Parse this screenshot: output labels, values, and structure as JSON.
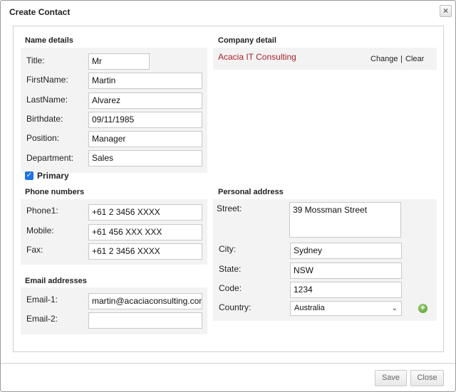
{
  "dialog": {
    "title": "Create Contact",
    "close_icon": "×"
  },
  "name_details": {
    "heading": "Name details",
    "title_label": "Title:",
    "title_value": "Mr",
    "firstname_label": "FirstName:",
    "firstname_value": "Martin",
    "lastname_label": "LastName:",
    "lastname_value": "Alvarez",
    "birthdate_label": "Birthdate:",
    "birthdate_value": "09/11/1985",
    "position_label": "Position:",
    "position_value": "Manager",
    "department_label": "Department:",
    "department_value": "Sales"
  },
  "primary": {
    "label": "Primary",
    "checked": true
  },
  "company_detail": {
    "heading": "Company detail",
    "name": "Acacia IT Consulting",
    "change_label": "Change",
    "separator": "|",
    "clear_label": "Clear"
  },
  "phone_numbers": {
    "heading": "Phone numbers",
    "phone1_label": "Phone1:",
    "phone1_value": "+61 2 3456 XXXX",
    "mobile_label": "Mobile:",
    "mobile_value": "+61 456 XXX XXX",
    "fax_label": "Fax:",
    "fax_value": "+61 2 3456 XXXX"
  },
  "email_addresses": {
    "heading": "Email addresses",
    "email1_label": "Email-1:",
    "email1_value": "martin@acaciaconsulting.com",
    "email2_label": "Email-2:",
    "email2_value": ""
  },
  "personal_address": {
    "heading": "Personal address",
    "street_label": "Street:",
    "street_value": "39 Mossman Street",
    "city_label": "City:",
    "city_value": "Sydney",
    "state_label": "State:",
    "state_value": "NSW",
    "code_label": "Code:",
    "code_value": "1234",
    "country_label": "Country:",
    "country_value": "Australia"
  },
  "footer": {
    "save_label": "Save",
    "close_label": "Close"
  },
  "colors": {
    "company_link": "#a8232b",
    "checkbox": "#1a73e8",
    "add_button": "#4f9a2c"
  }
}
